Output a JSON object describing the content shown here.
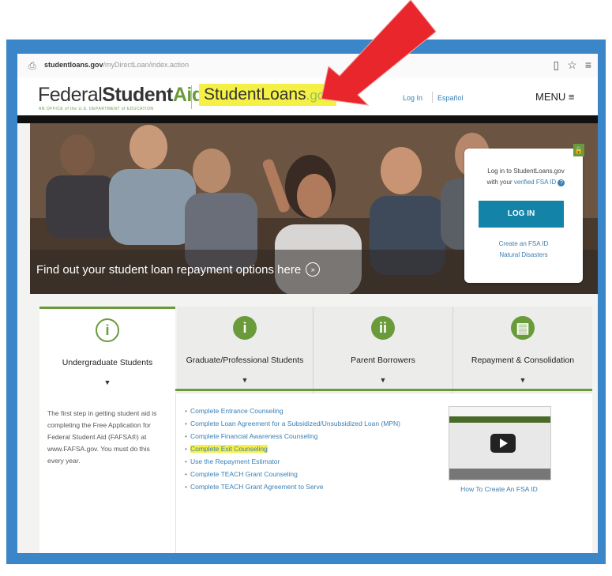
{
  "browser": {
    "url_domain": "studentloans.gov",
    "url_path": "/myDirectLoan/index.action",
    "icons": [
      "bookmark-icon",
      "star-icon",
      "menu-icon"
    ]
  },
  "header": {
    "fsa_logo_1": "Federal",
    "fsa_logo_2": "Student",
    "fsa_logo_3": "Aid",
    "fsa_tagline": "AN OFFICE of the U.S. DEPARTMENT of EDUCATION",
    "sl_logo_1": "StudentLoans",
    "sl_logo_2": ".gov",
    "login_link": "Log In",
    "lang_link": "Español",
    "menu_label": "MENU ≡"
  },
  "hero": {
    "caption": "Find out your student loan repayment options here",
    "caption_arrow": "»"
  },
  "login_card": {
    "prompt_1": "Log in to StudentLoans.gov",
    "prompt_2": "with your",
    "prompt_link": "verified FSA ID",
    "help": "?",
    "button": "LOG IN",
    "create_link": "Create an FSA ID",
    "disaster_link": "Natural Disasters"
  },
  "tabs": [
    {
      "label": "Undergraduate Students",
      "icon": "i",
      "chevron": "▼",
      "active": true
    },
    {
      "label": "Graduate/Professional Students",
      "icon": "i",
      "chevron": "▼",
      "active": false
    },
    {
      "label": "Parent Borrowers",
      "icon": "ii",
      "chevron": "▼",
      "active": false
    },
    {
      "label": "Repayment & Consolidation",
      "icon": "▤",
      "chevron": "▼",
      "active": false
    }
  ],
  "content": {
    "intro": "The first step in getting student aid is completing the Free Application for Federal Student Aid (FAFSA®) at www.FAFSA.gov. You must do this every year.",
    "links": [
      "Complete Entrance Counseling",
      "Complete Loan Agreement for a Subsidized/Unsubsidized Loan (MPN)",
      "Complete Financial Awareness Counseling",
      "Complete Exit Counseling",
      "Use the Repayment Estimator",
      "Complete TEACH Grant Counseling",
      "Complete TEACH Grant Agreement to Serve"
    ],
    "link_bullet": "•",
    "video_caption": "How To Create An FSA ID"
  },
  "colors": {
    "frame_blue": "#3a86c8",
    "fsa_green": "#6a9b3a",
    "link_blue": "#3a7fb5",
    "highlight_yellow": "#f4f046",
    "login_button": "#1483a8",
    "annotation_red": "#e8262c"
  }
}
